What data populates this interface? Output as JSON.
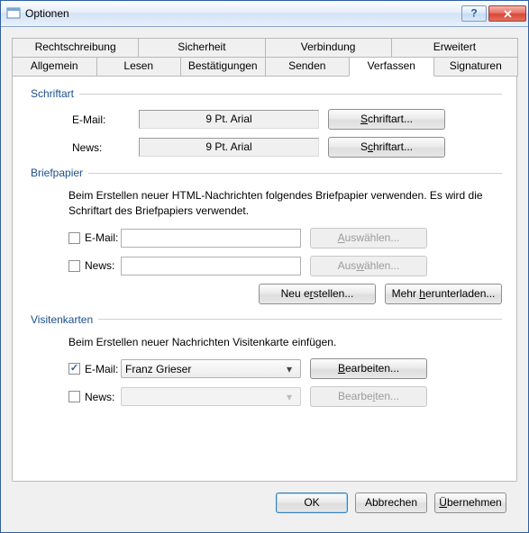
{
  "window": {
    "title": "Optionen"
  },
  "tabs": {
    "row1": [
      "Rechtschreibung",
      "Sicherheit",
      "Verbindung",
      "Erweitert"
    ],
    "row2": [
      "Allgemein",
      "Lesen",
      "Bestätigungen",
      "Senden",
      "Verfassen",
      "Signaturen"
    ],
    "active": "Verfassen"
  },
  "font": {
    "title": "Schriftart",
    "email_label": "E-Mail:",
    "email_value": "9 Pt. Arial",
    "news_label": "News:",
    "news_value": "9 Pt. Arial",
    "button": "Schriftart..."
  },
  "stationery": {
    "title": "Briefpapier",
    "desc": "Beim Erstellen neuer HTML-Nachrichten folgendes Briefpapier verwenden. Es wird die Schriftart des Briefpapiers verwendet.",
    "email_label": "E-Mail:",
    "email_checked": false,
    "email_value": "",
    "news_label": "News:",
    "news_checked": false,
    "news_value": "",
    "select_btn": "Auswählen...",
    "new_btn": "Neu erstellen...",
    "download_btn": "Mehr herunterladen..."
  },
  "vcards": {
    "title": "Visitenkarten",
    "desc": "Beim Erstellen neuer Nachrichten Visitenkarte einfügen.",
    "email_label": "E-Mail:",
    "email_checked": true,
    "email_value": "Franz Grieser",
    "news_label": "News:",
    "news_checked": false,
    "news_value": "",
    "edit_btn": "Bearbeiten..."
  },
  "footer": {
    "ok": "OK",
    "cancel": "Abbrechen",
    "apply": "Übernehmen"
  }
}
